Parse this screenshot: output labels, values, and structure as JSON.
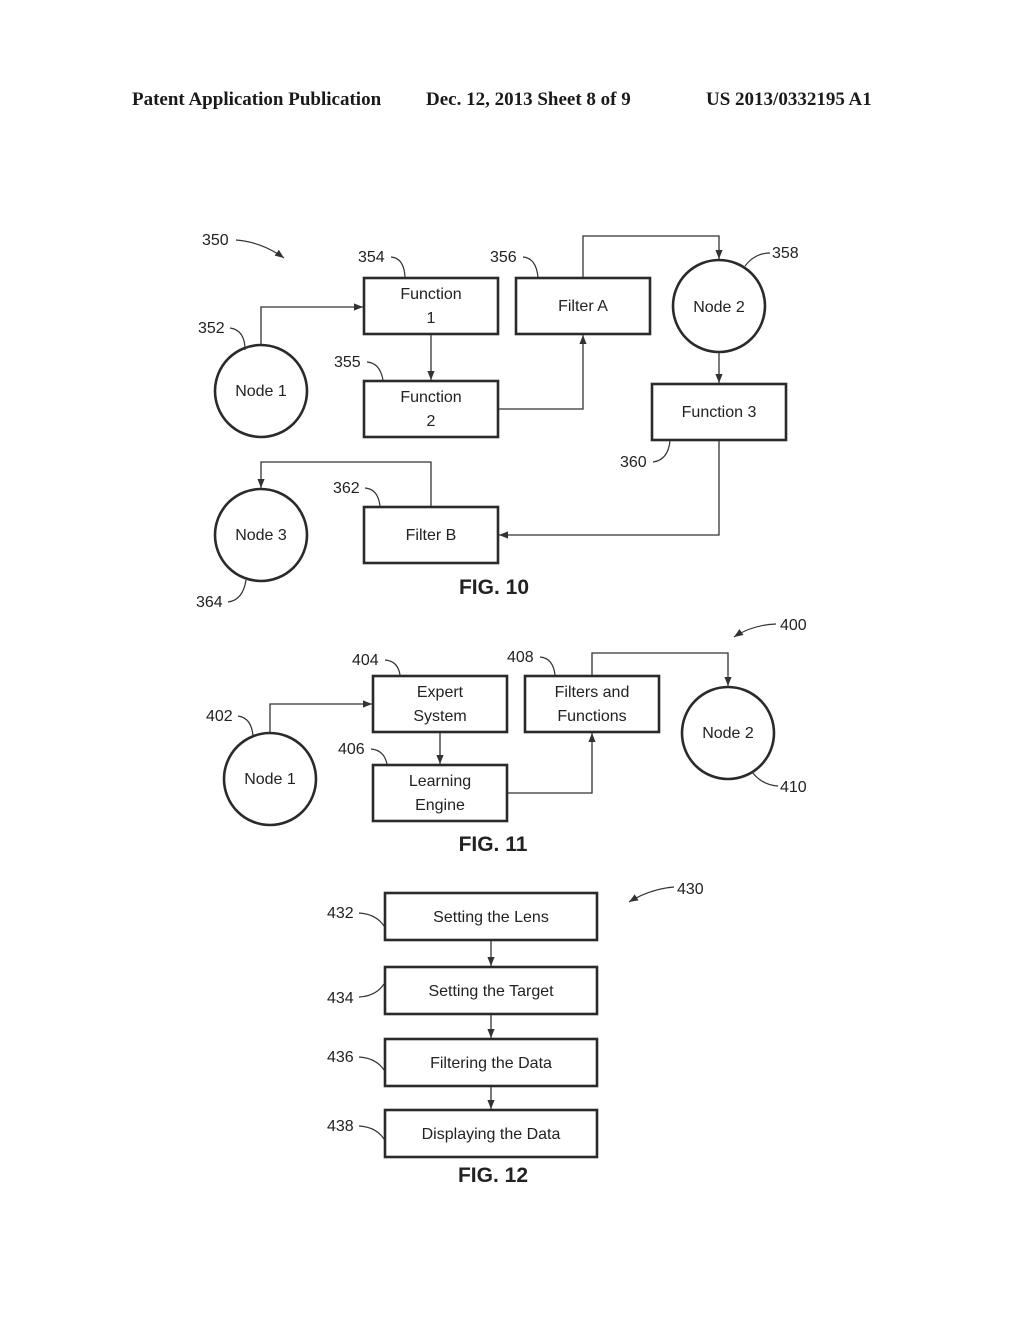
{
  "header": {
    "publication": "Patent Application Publication",
    "date_sheet": "Dec. 12, 2013   Sheet 8 of 9",
    "number": "US 2013/0332195 A1"
  },
  "fig10": {
    "caption": "FIG. 10",
    "ref_main": "350",
    "node1": {
      "ref": "352",
      "label": "Node 1"
    },
    "function1": {
      "ref": "354",
      "lines": [
        "Function",
        "1"
      ]
    },
    "function2": {
      "ref": "355",
      "lines": [
        "Function",
        "2"
      ]
    },
    "filterA": {
      "ref": "356",
      "label": "Filter A"
    },
    "node2": {
      "ref": "358",
      "label": "Node 2"
    },
    "function3": {
      "ref": "360",
      "label": "Function 3"
    },
    "filterB": {
      "ref": "362",
      "label": "Filter B"
    },
    "node3": {
      "ref": "364",
      "label": "Node 3"
    }
  },
  "fig11": {
    "caption": "FIG. 11",
    "ref_main": "400",
    "node1": {
      "ref": "402",
      "label": "Node 1"
    },
    "expert": {
      "ref": "404",
      "lines": [
        "Expert",
        "System"
      ]
    },
    "learning": {
      "ref": "406",
      "lines": [
        "Learning",
        "Engine"
      ]
    },
    "filters": {
      "ref": "408",
      "lines": [
        "Filters and",
        "Functions"
      ]
    },
    "node2": {
      "ref": "410",
      "label": "Node 2"
    }
  },
  "fig12": {
    "caption": "FIG. 12",
    "ref_main": "430",
    "steps": [
      {
        "ref": "432",
        "label": "Setting the Lens"
      },
      {
        "ref": "434",
        "label": "Setting the Target"
      },
      {
        "ref": "436",
        "label": "Filtering the Data"
      },
      {
        "ref": "438",
        "label": "Displaying the Data"
      }
    ]
  }
}
